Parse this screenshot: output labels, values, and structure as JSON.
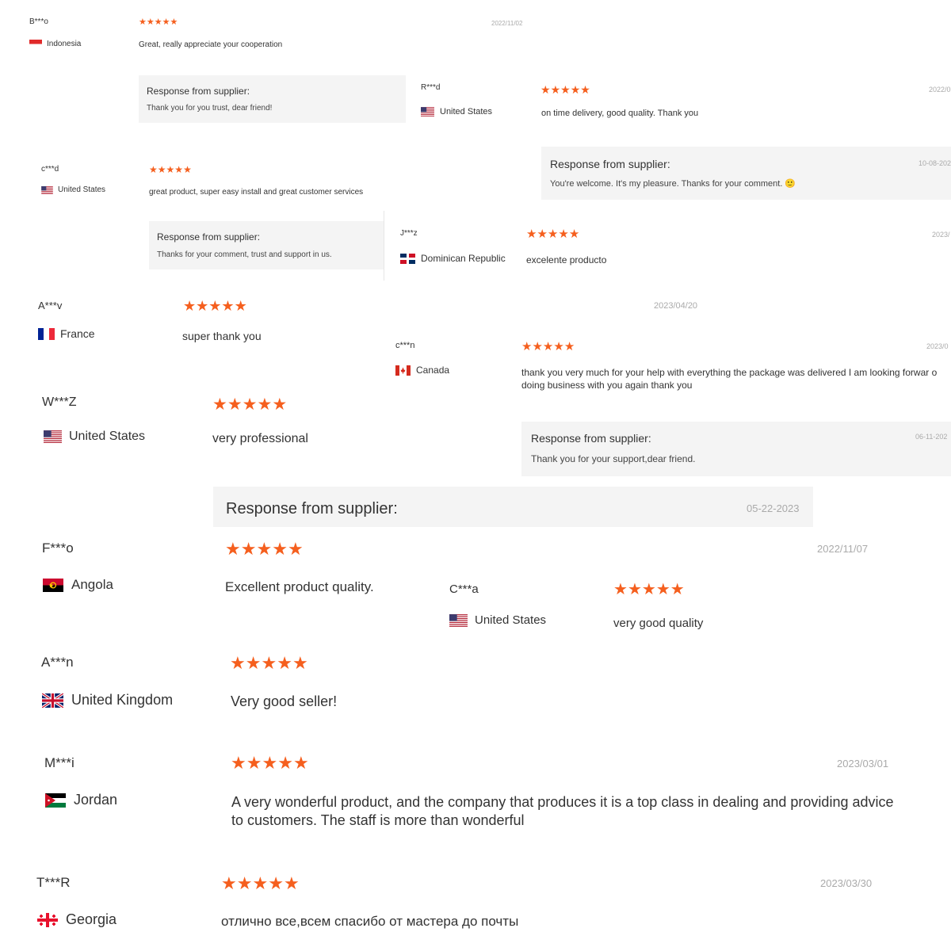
{
  "colors": {
    "star": "#f55f1e",
    "date": "#aaaaaa",
    "response_bg": "#f4f4f4",
    "text": "#333333"
  },
  "icons": {
    "star": "star-icon"
  },
  "reviews": [
    {
      "user": "B***o",
      "country": "Indonesia",
      "flag": "flag-indonesia-icon",
      "rating": 5,
      "date": "2022/11/02",
      "comment": "Great, really appreciate your cooperation",
      "response": {
        "title": "Response from supplier:",
        "text": "Thank you for you trust, dear friend!",
        "date": ""
      }
    },
    {
      "user": "R***d",
      "country": "United States",
      "flag": "flag-united-states-icon",
      "rating": 5,
      "date": "2022/0",
      "comment": "on time delivery, good quality. Thank you",
      "response": {
        "title": "Response from supplier:",
        "text": "You're welcome. It's my pleasure. Thanks for your comment. 🙂",
        "date": "10-08-202"
      }
    },
    {
      "user": "c***d",
      "country": "United States",
      "flag": "flag-united-states-icon",
      "rating": 5,
      "date": "",
      "comment": "great product, super easy install and great customer services",
      "response": {
        "title": "Response from supplier:",
        "text": "Thanks for your comment, trust and support in us.",
        "date": ""
      }
    },
    {
      "user": "J***z",
      "country": "Dominican Republic",
      "flag": "flag-dominican-republic-icon",
      "rating": 5,
      "date": "2023/",
      "comment": "excelente producto",
      "response": null
    },
    {
      "user": "A***v",
      "country": "France",
      "flag": "flag-france-icon",
      "rating": 5,
      "date": "2023/04/20",
      "comment": "super thank you",
      "response": null
    },
    {
      "user": "c***n",
      "country": "Canada",
      "flag": "flag-canada-icon",
      "rating": 5,
      "date": "2023/0",
      "comment": "thank you very much for your help with everything the package was delivered I am looking forwar o doing business with you again thank you",
      "response": {
        "title": "Response from supplier:",
        "text": "Thank you for your support,dear friend.",
        "date": "06-11-202"
      }
    },
    {
      "user": "W***Z",
      "country": "United States",
      "flag": "flag-united-states-icon",
      "rating": 5,
      "date": "",
      "comment": "very professional",
      "response": {
        "title": "Response from supplier:",
        "text": "",
        "date": "05-22-2023"
      }
    },
    {
      "user": "F***o",
      "country": "Angola",
      "flag": "flag-angola-icon",
      "rating": 5,
      "date": "2022/11/07",
      "comment": "Excellent product quality.",
      "response": null
    },
    {
      "user": "C***a",
      "country": "United States",
      "flag": "flag-united-states-icon",
      "rating": 5,
      "date": "",
      "comment": "very good quality",
      "response": null
    },
    {
      "user": "A***n",
      "country": "United Kingdom",
      "flag": "flag-united-kingdom-icon",
      "rating": 5,
      "date": "",
      "comment": "Very good seller!",
      "response": null
    },
    {
      "user": "M***i",
      "country": "Jordan",
      "flag": "flag-jordan-icon",
      "rating": 5,
      "date": "2023/03/01",
      "comment": "A very wonderful product, and the company that produces it is a top class in dealing and providing advice to customers. The staff is more than wonderful",
      "response": null
    },
    {
      "user": "T***R",
      "country": "Georgia",
      "flag": "flag-georgia-icon",
      "rating": 5,
      "date": "2023/03/30",
      "comment": "отлично все,всем спасибо от мастера до почты",
      "response": null
    }
  ]
}
